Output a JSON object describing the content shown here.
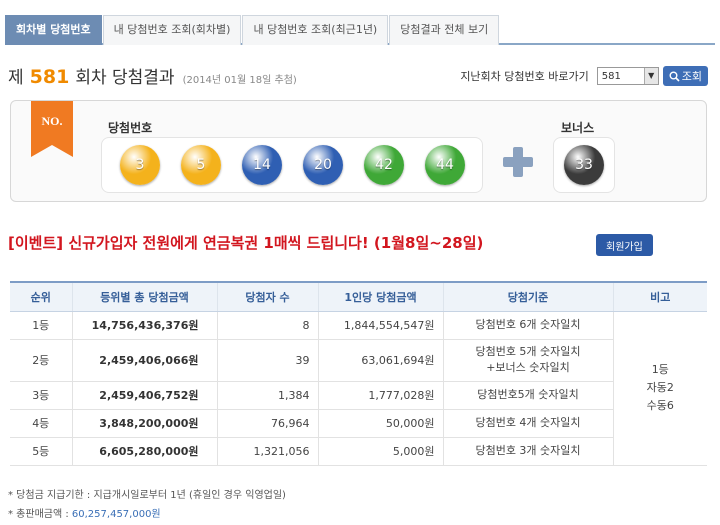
{
  "tabs": [
    {
      "label": "회차별 당첨번호",
      "active": true
    },
    {
      "label": "내 당첨번호 조회(회차별)",
      "active": false
    },
    {
      "label": "내 당첨번호 조회(최근1년)",
      "active": false
    },
    {
      "label": "당첨결과 전체 보기",
      "active": false
    }
  ],
  "title": {
    "prefix": "제",
    "round": "581",
    "suffix": "회차 당첨결과",
    "date": "(2014년 01월 18일 추첨)"
  },
  "jump": {
    "label": "지난회차 당첨번호 바로가기",
    "selected": "581",
    "button": "조회"
  },
  "result": {
    "ribbon": "NO.",
    "win_label": "당첨번호",
    "bonus_label": "보너스",
    "numbers": [
      {
        "n": "3",
        "color": "#f4b21c"
      },
      {
        "n": "5",
        "color": "#f4b21c"
      },
      {
        "n": "14",
        "color": "#2f5fb3"
      },
      {
        "n": "20",
        "color": "#2f5fb3"
      },
      {
        "n": "42",
        "color": "#3fa837"
      },
      {
        "n": "44",
        "color": "#3fa837"
      }
    ],
    "bonus": {
      "n": "33",
      "color": "#3b3b3b"
    }
  },
  "event": {
    "text": "[이벤트] 신규가입자 전원에게 연금복권 1매씩 드립니다! (1월8일~28일)",
    "button": "회원가입"
  },
  "table": {
    "headers": [
      "순위",
      "등위별 총 당첨금액",
      "당첨자 수",
      "1인당 당첨금액",
      "당첨기준",
      "비고"
    ],
    "rows": [
      {
        "rank": "1등",
        "total": "14,756,436,376원",
        "winners": "8",
        "per": "1,844,554,547원",
        "std1": "당첨번호 6개 숫자일치",
        "std2": ""
      },
      {
        "rank": "2등",
        "total": "2,459,406,066원",
        "winners": "39",
        "per": "63,061,694원",
        "std1": "당첨번호 5개 숫자일치",
        "std2": "+보너스 숫자일치"
      },
      {
        "rank": "3등",
        "total": "2,459,406,752원",
        "winners": "1,384",
        "per": "1,777,028원",
        "std1": "당첨번호5개 숫자일치",
        "std2": ""
      },
      {
        "rank": "4등",
        "total": "3,848,200,000원",
        "winners": "76,964",
        "per": "50,000원",
        "std1": "당첨번호 4개 숫자일치",
        "std2": ""
      },
      {
        "rank": "5등",
        "total": "6,605,280,000원",
        "winners": "1,321,056",
        "per": "5,000원",
        "std1": "당첨번호 3개 숫자일치",
        "std2": ""
      }
    ],
    "note": {
      "line1": "1등",
      "line2": "자동2",
      "line3": "수동6"
    }
  },
  "footer": {
    "line1": "* 당첨금 지급기한 : 지급개시일로부터 1년 (휴일인 경우 익영업일)",
    "line2_label": "* 총판매금액 : ",
    "line2_value": "60,257,457,000원"
  }
}
